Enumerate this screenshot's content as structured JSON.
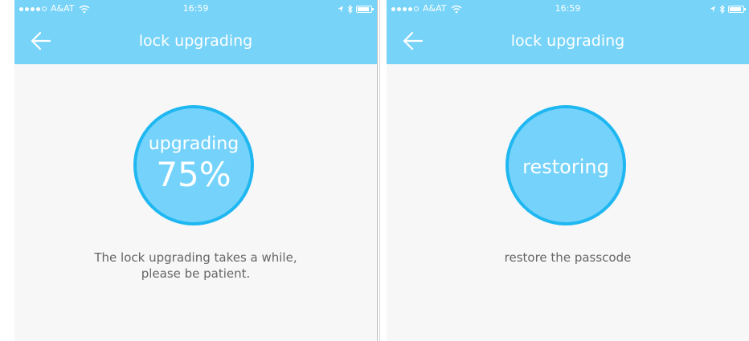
{
  "screens": [
    {
      "status": {
        "carrier": "A&AT",
        "time": "16:59"
      },
      "nav": {
        "title": "lock upgrading"
      },
      "progress": {
        "label": "upgrading",
        "percent_text": "75%",
        "value": 0.75
      },
      "message": {
        "line1": "The lock upgrading takes a while,",
        "line2": "please be patient."
      }
    },
    {
      "status": {
        "carrier": "A&AT",
        "time": "16:59"
      },
      "nav": {
        "title": "lock upgrading"
      },
      "progress": {
        "label": "restoring"
      },
      "message": {
        "line1": "restore the passcode"
      }
    }
  ],
  "colors": {
    "header": "#77d3f8",
    "circle_fill": "#75d3fb",
    "circle_ring": "#1fb7f1",
    "background": "#f7f7f7",
    "message_text": "#666666"
  },
  "icons": {
    "back": "arrow-left-icon",
    "wifi": "wifi-icon",
    "location": "location-arrow-icon",
    "bluetooth": "bluetooth-icon",
    "battery": "battery-icon"
  }
}
